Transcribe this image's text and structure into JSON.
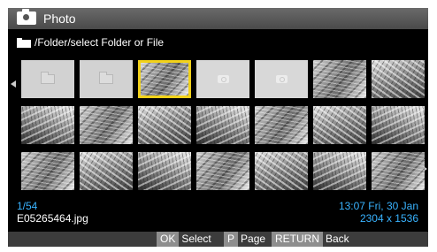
{
  "header": {
    "title": "Photo",
    "icon": "camera-icon"
  },
  "path": {
    "icon": "folder-icon",
    "text": "/Folder/select Folder or File"
  },
  "grid": {
    "selected_index": 2,
    "highlight_color": "#f2d21a",
    "items": [
      {
        "kind": "folder"
      },
      {
        "kind": "folder"
      },
      {
        "kind": "photo"
      },
      {
        "kind": "placeholder"
      },
      {
        "kind": "placeholder"
      },
      {
        "kind": "photo"
      },
      {
        "kind": "photo"
      },
      {
        "kind": "photo"
      },
      {
        "kind": "photo"
      },
      {
        "kind": "photo"
      },
      {
        "kind": "photo"
      },
      {
        "kind": "photo"
      },
      {
        "kind": "photo"
      },
      {
        "kind": "photo"
      },
      {
        "kind": "photo"
      },
      {
        "kind": "photo"
      },
      {
        "kind": "photo"
      },
      {
        "kind": "photo"
      },
      {
        "kind": "photo"
      },
      {
        "kind": "photo"
      },
      {
        "kind": "photo"
      }
    ]
  },
  "info": {
    "counter": "1/54",
    "filename": "E05265464.jpg",
    "datetime": "13:07 Fri, 30 Jan",
    "resolution": "2304 x 1536",
    "accent_color": "#39b3ff"
  },
  "footer": {
    "ok_key": "OK",
    "ok_label": "Select",
    "page_key": "P",
    "page_label": "Page",
    "return_key": "RETURN",
    "return_label": "Back"
  }
}
